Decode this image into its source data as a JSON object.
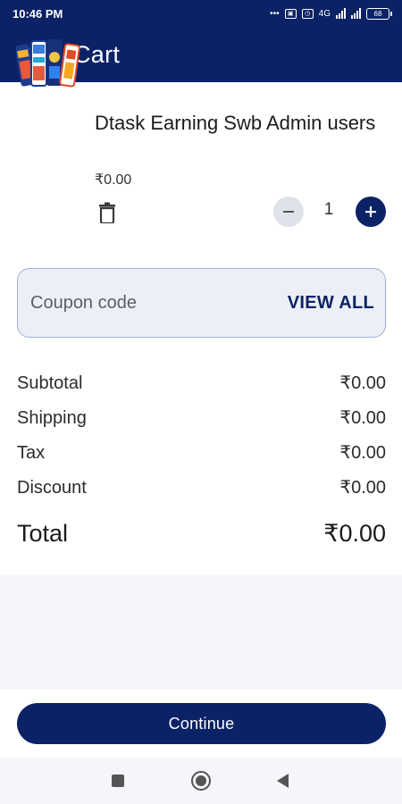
{
  "status_bar": {
    "time": "10:46 PM",
    "network_label": "4G",
    "battery": "68"
  },
  "app_bar": {
    "title": "Cart"
  },
  "cart_item": {
    "name": "Dtask Earning Swb Admin users",
    "price": "₹0.00",
    "quantity": "1"
  },
  "coupon": {
    "placeholder": "Coupon code",
    "view_all_label": "VIEW ALL"
  },
  "summary": {
    "rows": [
      {
        "label": "Subtotal",
        "value": "₹0.00"
      },
      {
        "label": "Shipping",
        "value": "₹0.00"
      },
      {
        "label": "Tax",
        "value": "₹0.00"
      },
      {
        "label": "Discount",
        "value": "₹0.00"
      }
    ],
    "total_label": "Total",
    "total_value": "₹0.00"
  },
  "footer": {
    "continue_label": "Continue"
  },
  "colors": {
    "primary": "#0b2266",
    "background": "#f5f6f9"
  },
  "icons": [
    "back-arrow-icon",
    "trash-icon",
    "minus-icon",
    "plus-icon",
    "nav-recents-icon",
    "nav-home-icon",
    "nav-back-icon"
  ]
}
